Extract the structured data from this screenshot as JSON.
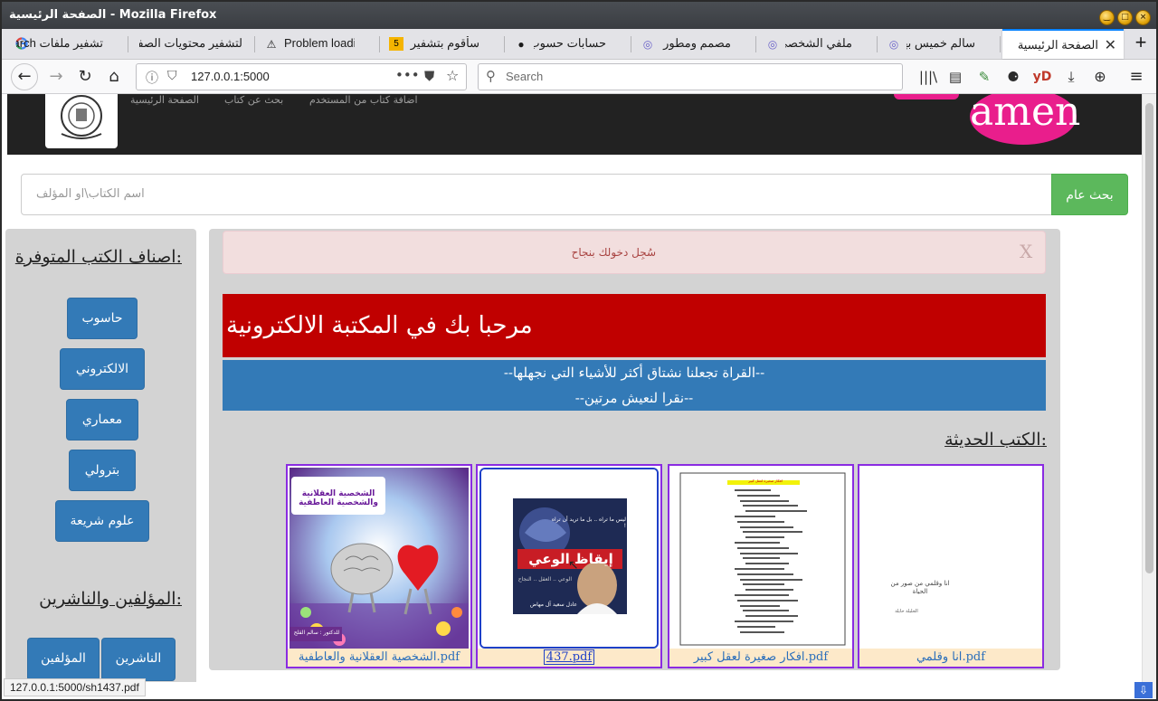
{
  "window": {
    "title": "الصفحة الرئيسية - Mozilla Firefox"
  },
  "tabs": [
    {
      "label": "الصفحة الرئيسية",
      "active": true
    },
    {
      "label": "سالم خميس بهيان",
      "icon": "podcast-icon"
    },
    {
      "label": "ملفي الشخصي",
      "icon": "podcast-icon"
    },
    {
      "label": "مصمم ومطور واجهات",
      "icon": "podcast-icon"
    },
    {
      "label": "حسابات حسوب - ح",
      "icon": "record-icon"
    },
    {
      "label": "سأقوم بتشفير أكواد",
      "icon": "badge-5-icon"
    },
    {
      "label": "Problem loading",
      "icon": "warning-icon"
    },
    {
      "label": "لتشفير محتويات الصفحة",
      "icon": ""
    },
    {
      "label": "تشفير ملفات search",
      "icon": "google-icon"
    }
  ],
  "nav": {
    "url": "127.0.0.1:5000",
    "search_placeholder": "Search"
  },
  "site": {
    "brand": "amen",
    "nav_links": [
      "الصفحة الرئيسية",
      "بحث عن كتاب",
      "اضافة كتاب من المستخدم"
    ],
    "search_placeholder": "اسم الكتاب\\او المؤلف",
    "search_button": "بحث عام"
  },
  "sidebar": {
    "categories_heading": "اصناف الكتب المتوفرة:",
    "categories": [
      "حاسوب",
      "الالكتروني",
      "معماري",
      "بترولي",
      "علوم شريعة"
    ],
    "authors_heading": "المؤلفين والناشرين:",
    "authors_buttons": [
      "الناشرين",
      "المؤلفين"
    ]
  },
  "main": {
    "alert_text": "سُجِل دخولك بنجاح",
    "alert_close": "X",
    "welcome": "مرحبا بك في المكتبة الالكترونية",
    "quote_line1": "--القراة تجعلنا نشتاق أكثر للأشياء التي نجهلها--",
    "quote_line2": "--نقرا لنعيش مرتين--",
    "recent_heading": "الكتب الحديثة:",
    "books": [
      {
        "file": "الشخصية العقلانية والعاطفية.pdf",
        "cover_title": "الشخصية العقلانية والشخصية العاطفية",
        "cover_author": "للدكتور : سالم القلح"
      },
      {
        "file": "437.pdf",
        "cover_title": "إيقاظ الوعي",
        "cover_sub": "ليس ما تراه .. بل ما تريد أن تراه !",
        "cover_lines": "الوعي .. العقل .. النجاح",
        "cover_author": "عادل سعيد آل مهاض"
      },
      {
        "file": "افكار صغيرة لعقل كبير.pdf",
        "cover_title": "افكار صغيرة لعقل كبير"
      },
      {
        "file": "انا وقلمي.pdf",
        "cover_title": "انا وقلمي من صور من الحياة",
        "cover_author": "الجليلة حايلة"
      }
    ]
  },
  "status": "127.0.0.1:5000/sh1437.pdf"
}
